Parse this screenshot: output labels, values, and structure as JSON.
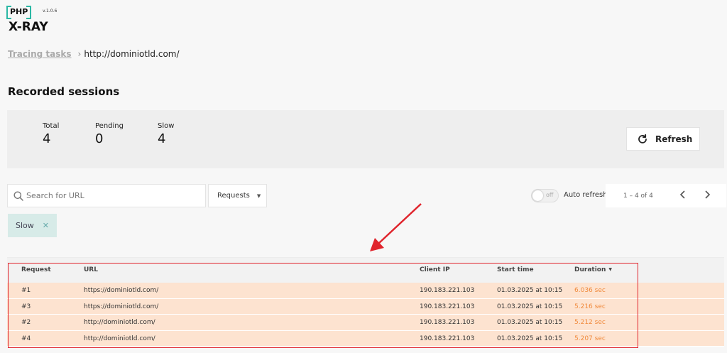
{
  "logo": {
    "php": "PHP",
    "version": "v.1.0.6",
    "name": "X-RAY"
  },
  "breadcrumb": {
    "parent": "Tracing tasks",
    "current": "http://dominiotld.com/"
  },
  "page_title": "Recorded sessions",
  "stats": [
    {
      "label": "Total",
      "value": "4"
    },
    {
      "label": "Pending",
      "value": "0"
    },
    {
      "label": "Slow",
      "value": "4"
    }
  ],
  "refresh_label": "Refresh",
  "search": {
    "placeholder": "Search for URL",
    "value": ""
  },
  "requests_dropdown": "Requests",
  "toggle": {
    "state_text": "off"
  },
  "auto_refresh_label": "Auto refresh",
  "pager": {
    "text": "1 – 4 of 4"
  },
  "filter_chip": "Slow",
  "table": {
    "headers": {
      "request": "Request",
      "url": "URL",
      "client_ip": "Client IP",
      "start_time": "Start time",
      "duration": "Duration"
    },
    "rows": [
      {
        "request": "#1",
        "url": "https://dominiotld.com/",
        "client_ip": "190.183.221.103",
        "start_time": "01.03.2025 at 10:15",
        "duration": "6.036 sec"
      },
      {
        "request": "#3",
        "url": "https://dominiotld.com/",
        "client_ip": "190.183.221.103",
        "start_time": "01.03.2025 at 10:15",
        "duration": "5.216 sec"
      },
      {
        "request": "#2",
        "url": "http://dominiotld.com/",
        "client_ip": "190.183.221.103",
        "start_time": "01.03.2025 at 10:15",
        "duration": "5.212 sec"
      },
      {
        "request": "#4",
        "url": "http://dominiotld.com/",
        "client_ip": "190.183.221.103",
        "start_time": "01.03.2025 at 10:15",
        "duration": "5.207 sec"
      }
    ]
  },
  "colors": {
    "accent_teal": "#2bb8a4",
    "slow_row": "#fde3d0",
    "duration_text": "#f08a3c",
    "annotation_red": "#e0242c"
  },
  "icons": {
    "refresh": "refresh-icon",
    "search": "search-icon",
    "prev": "chevron-left-icon",
    "next": "chevron-right-icon",
    "chip_close": "close-icon"
  }
}
